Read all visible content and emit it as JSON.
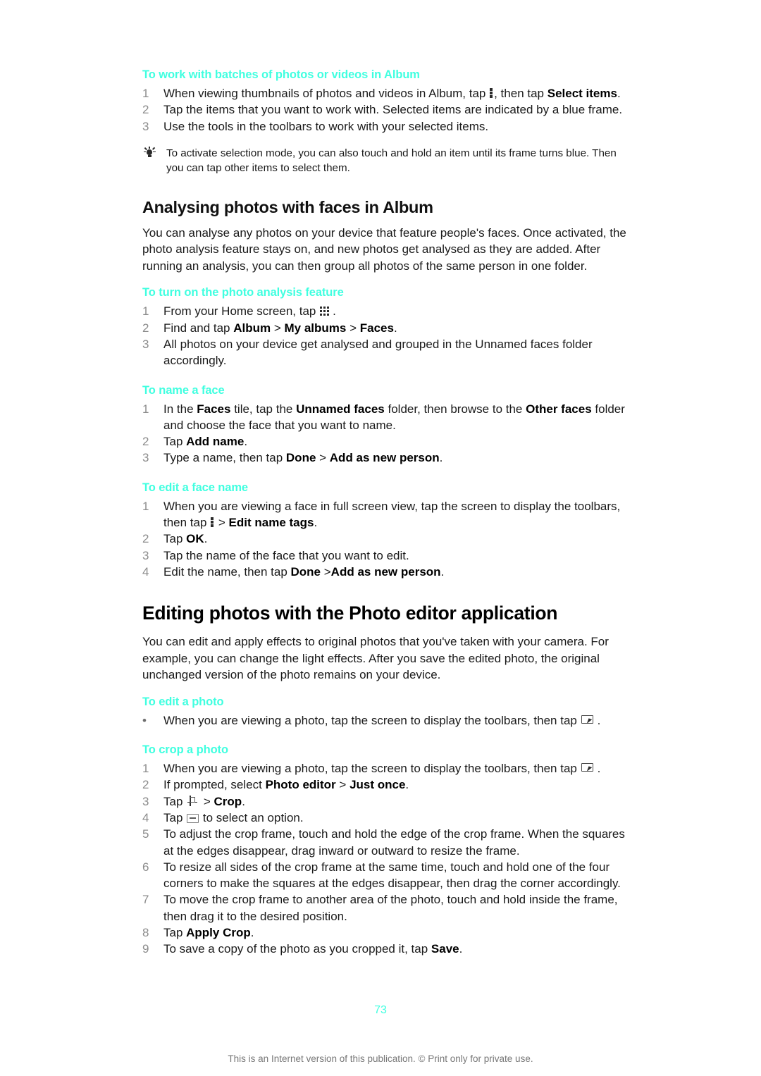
{
  "document": {
    "page_number": "73",
    "footer_note": "This is an Internet version of this publication. © Print only for private use.",
    "accent_color": "#40ffe0",
    "text_color": "#1a1a1a",
    "list_number_color": "#8c8c8c"
  },
  "sections": {
    "batches": {
      "heading": "To work with batches of photos or videos in Album",
      "steps": [
        {
          "num": "1",
          "pre": "When viewing thumbnails of photos and videos in Album, tap ",
          "icon": "kebab-menu-icon",
          "mid": ", then tap ",
          "bold": "Select items",
          "post": "."
        },
        {
          "num": "2",
          "text": "Tap the items that you want to work with. Selected items are indicated by a blue frame."
        },
        {
          "num": "3",
          "text": "Use the tools in the toolbars to work with your selected items."
        }
      ],
      "tip": {
        "icon": "lightbulb-icon",
        "text": "To activate selection mode, you can also touch and hold an item until its frame turns blue. Then you can tap other items to select them."
      }
    },
    "analysing": {
      "heading": "Analysing photos with faces in Album",
      "body": "You can analyse any photos on your device that feature people's faces. Once activated, the photo analysis feature stays on, and new photos get analysed as they are added. After running an analysis, you can then group all photos of the same person in one folder.",
      "turn_on": {
        "heading": "To turn on the photo analysis feature",
        "steps": [
          {
            "num": "1",
            "pre": "From your Home screen, tap ",
            "icon": "apps-grid-icon",
            "post": "."
          },
          {
            "num": "2",
            "pre": "Find and tap ",
            "bold1": "Album",
            "sep1": " > ",
            "bold2": "My albums",
            "sep2": " > ",
            "bold3": "Faces",
            "post": "."
          },
          {
            "num": "3",
            "text": "All photos on your device get analysed and grouped in the Unnamed faces folder accordingly."
          }
        ]
      },
      "name_face": {
        "heading": "To name a face",
        "steps": [
          {
            "num": "1",
            "pre": "In the ",
            "bold1": "Faces",
            "mid1": " tile, tap the ",
            "bold2": "Unnamed faces",
            "mid2": " folder, then browse to the ",
            "bold3": "Other faces",
            "post": " folder and choose the face that you want to name."
          },
          {
            "num": "2",
            "pre": "Tap ",
            "bold1": "Add name",
            "post": "."
          },
          {
            "num": "3",
            "pre": "Type a name, then tap ",
            "bold1": "Done",
            "sep1": " > ",
            "bold2": "Add as new person",
            "post": "."
          }
        ]
      },
      "edit_face": {
        "heading": "To edit a face name",
        "steps": [
          {
            "num": "1",
            "pre": "When you are viewing a face in full screen view, tap the screen to display the toolbars, then tap ",
            "icon": "kebab-menu-icon",
            "mid": " > ",
            "bold1": "Edit name tags",
            "post": "."
          },
          {
            "num": "2",
            "pre": "Tap ",
            "bold1": "OK",
            "post": "."
          },
          {
            "num": "3",
            "text": "Tap the name of the face that you want to edit."
          },
          {
            "num": "4",
            "pre": "Edit the name, then tap ",
            "bold1": "Done",
            "sep1": " >",
            "bold2": "Add as new person",
            "post": "."
          }
        ]
      }
    },
    "photo_editor": {
      "heading": "Editing photos with the Photo editor application",
      "body": "You can edit and apply effects to original photos that you've taken with your camera. For example, you can change the light effects. After you save the edited photo, the original unchanged version of the photo remains on your device.",
      "edit_photo": {
        "heading": "To edit a photo",
        "steps": [
          {
            "bullet": "•",
            "pre": "When you are viewing a photo, tap the screen to display the toolbars, then tap ",
            "icon": "photo-editor-icon",
            "post": "."
          }
        ]
      },
      "crop_photo": {
        "heading": "To crop a photo",
        "steps": [
          {
            "num": "1",
            "pre": "When you are viewing a photo, tap the screen to display the toolbars, then tap ",
            "icon": "photo-editor-icon",
            "post": "."
          },
          {
            "num": "2",
            "pre": "If prompted, select ",
            "bold1": "Photo editor",
            "sep1": " > ",
            "bold2": "Just once",
            "post": "."
          },
          {
            "num": "3",
            "pre": "Tap ",
            "icon": "crop-icon",
            "mid": " > ",
            "bold1": "Crop",
            "post": "."
          },
          {
            "num": "4",
            "pre": "Tap ",
            "icon": "select-option-icon",
            "post": " to select an option."
          },
          {
            "num": "5",
            "text": "To adjust the crop frame, touch and hold the edge of the crop frame. When the squares at the edges disappear, drag inward or outward to resize the frame."
          },
          {
            "num": "6",
            "text": "To resize all sides of the crop frame at the same time, touch and hold one of the four corners to make the squares at the edges disappear, then drag the corner accordingly."
          },
          {
            "num": "7",
            "text": "To move the crop frame to another area of the photo, touch and hold inside the frame, then drag it to the desired position."
          },
          {
            "num": "8",
            "pre": "Tap ",
            "bold1": "Apply Crop",
            "post": "."
          },
          {
            "num": "9",
            "pre": "To save a copy of the photo as you cropped it, tap ",
            "bold1": "Save",
            "post": "."
          }
        ]
      }
    }
  }
}
